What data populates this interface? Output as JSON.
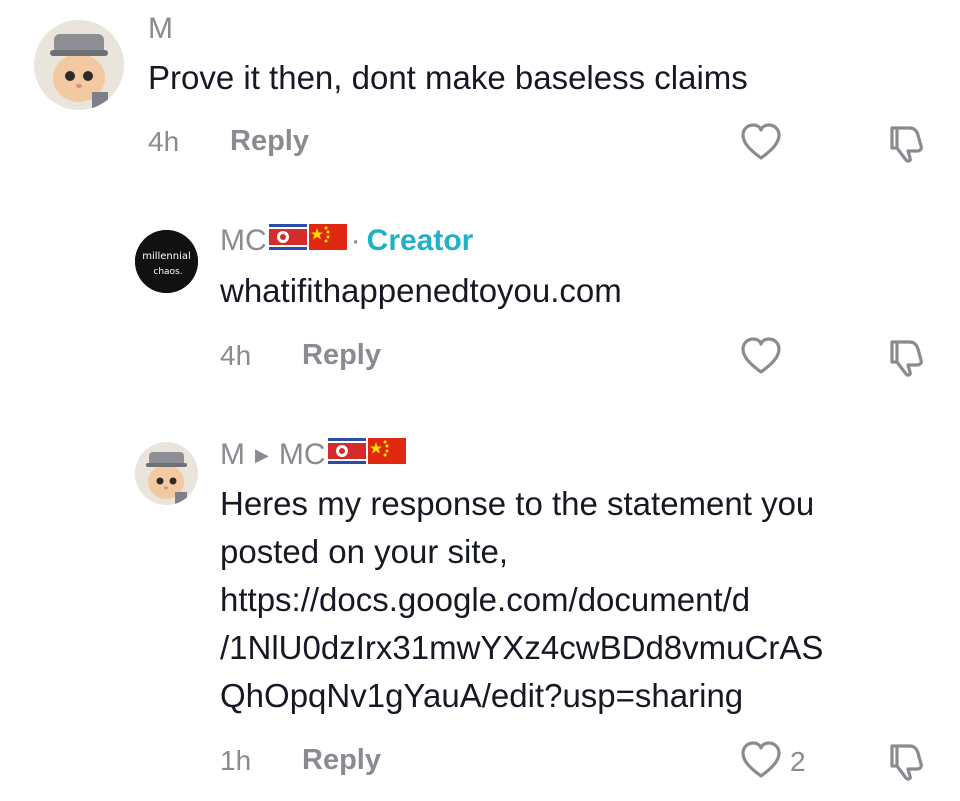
{
  "comments": [
    {
      "username": "M",
      "text": "Prove it then, dont make baseless claims",
      "time": "4h",
      "reply_label": "Reply",
      "like_count": ""
    },
    {
      "username": "MC",
      "creator_label": "Creator",
      "avatar_text_line1": "millennial",
      "avatar_text_line2": "chaos.",
      "text": "whatifithappenedtoyou.com",
      "time": "4h",
      "reply_label": "Reply",
      "like_count": ""
    },
    {
      "username": "M",
      "reply_to": "MC",
      "text_lines": [
        "Heres my response to the statement you",
        "posted on your site,",
        "https://docs.google.com/document/d",
        "/1NlU0dzIrx31mwYXz4cwBDd8vmuCrAS",
        "QhOpqNv1gYauA/edit?usp=sharing"
      ],
      "time": "1h",
      "reply_label": "Reply",
      "like_count": "2"
    }
  ],
  "icons": {
    "like": "heart-outline-icon",
    "dislike": "thumbs-down-outline-icon",
    "reply_arrow": "triangle-right-icon",
    "flags": [
      "north-korea-flag",
      "china-flag"
    ]
  },
  "colors": {
    "text_primary": "#161823",
    "text_secondary": "#8a8b91",
    "creator_accent": "#20b0c8"
  }
}
